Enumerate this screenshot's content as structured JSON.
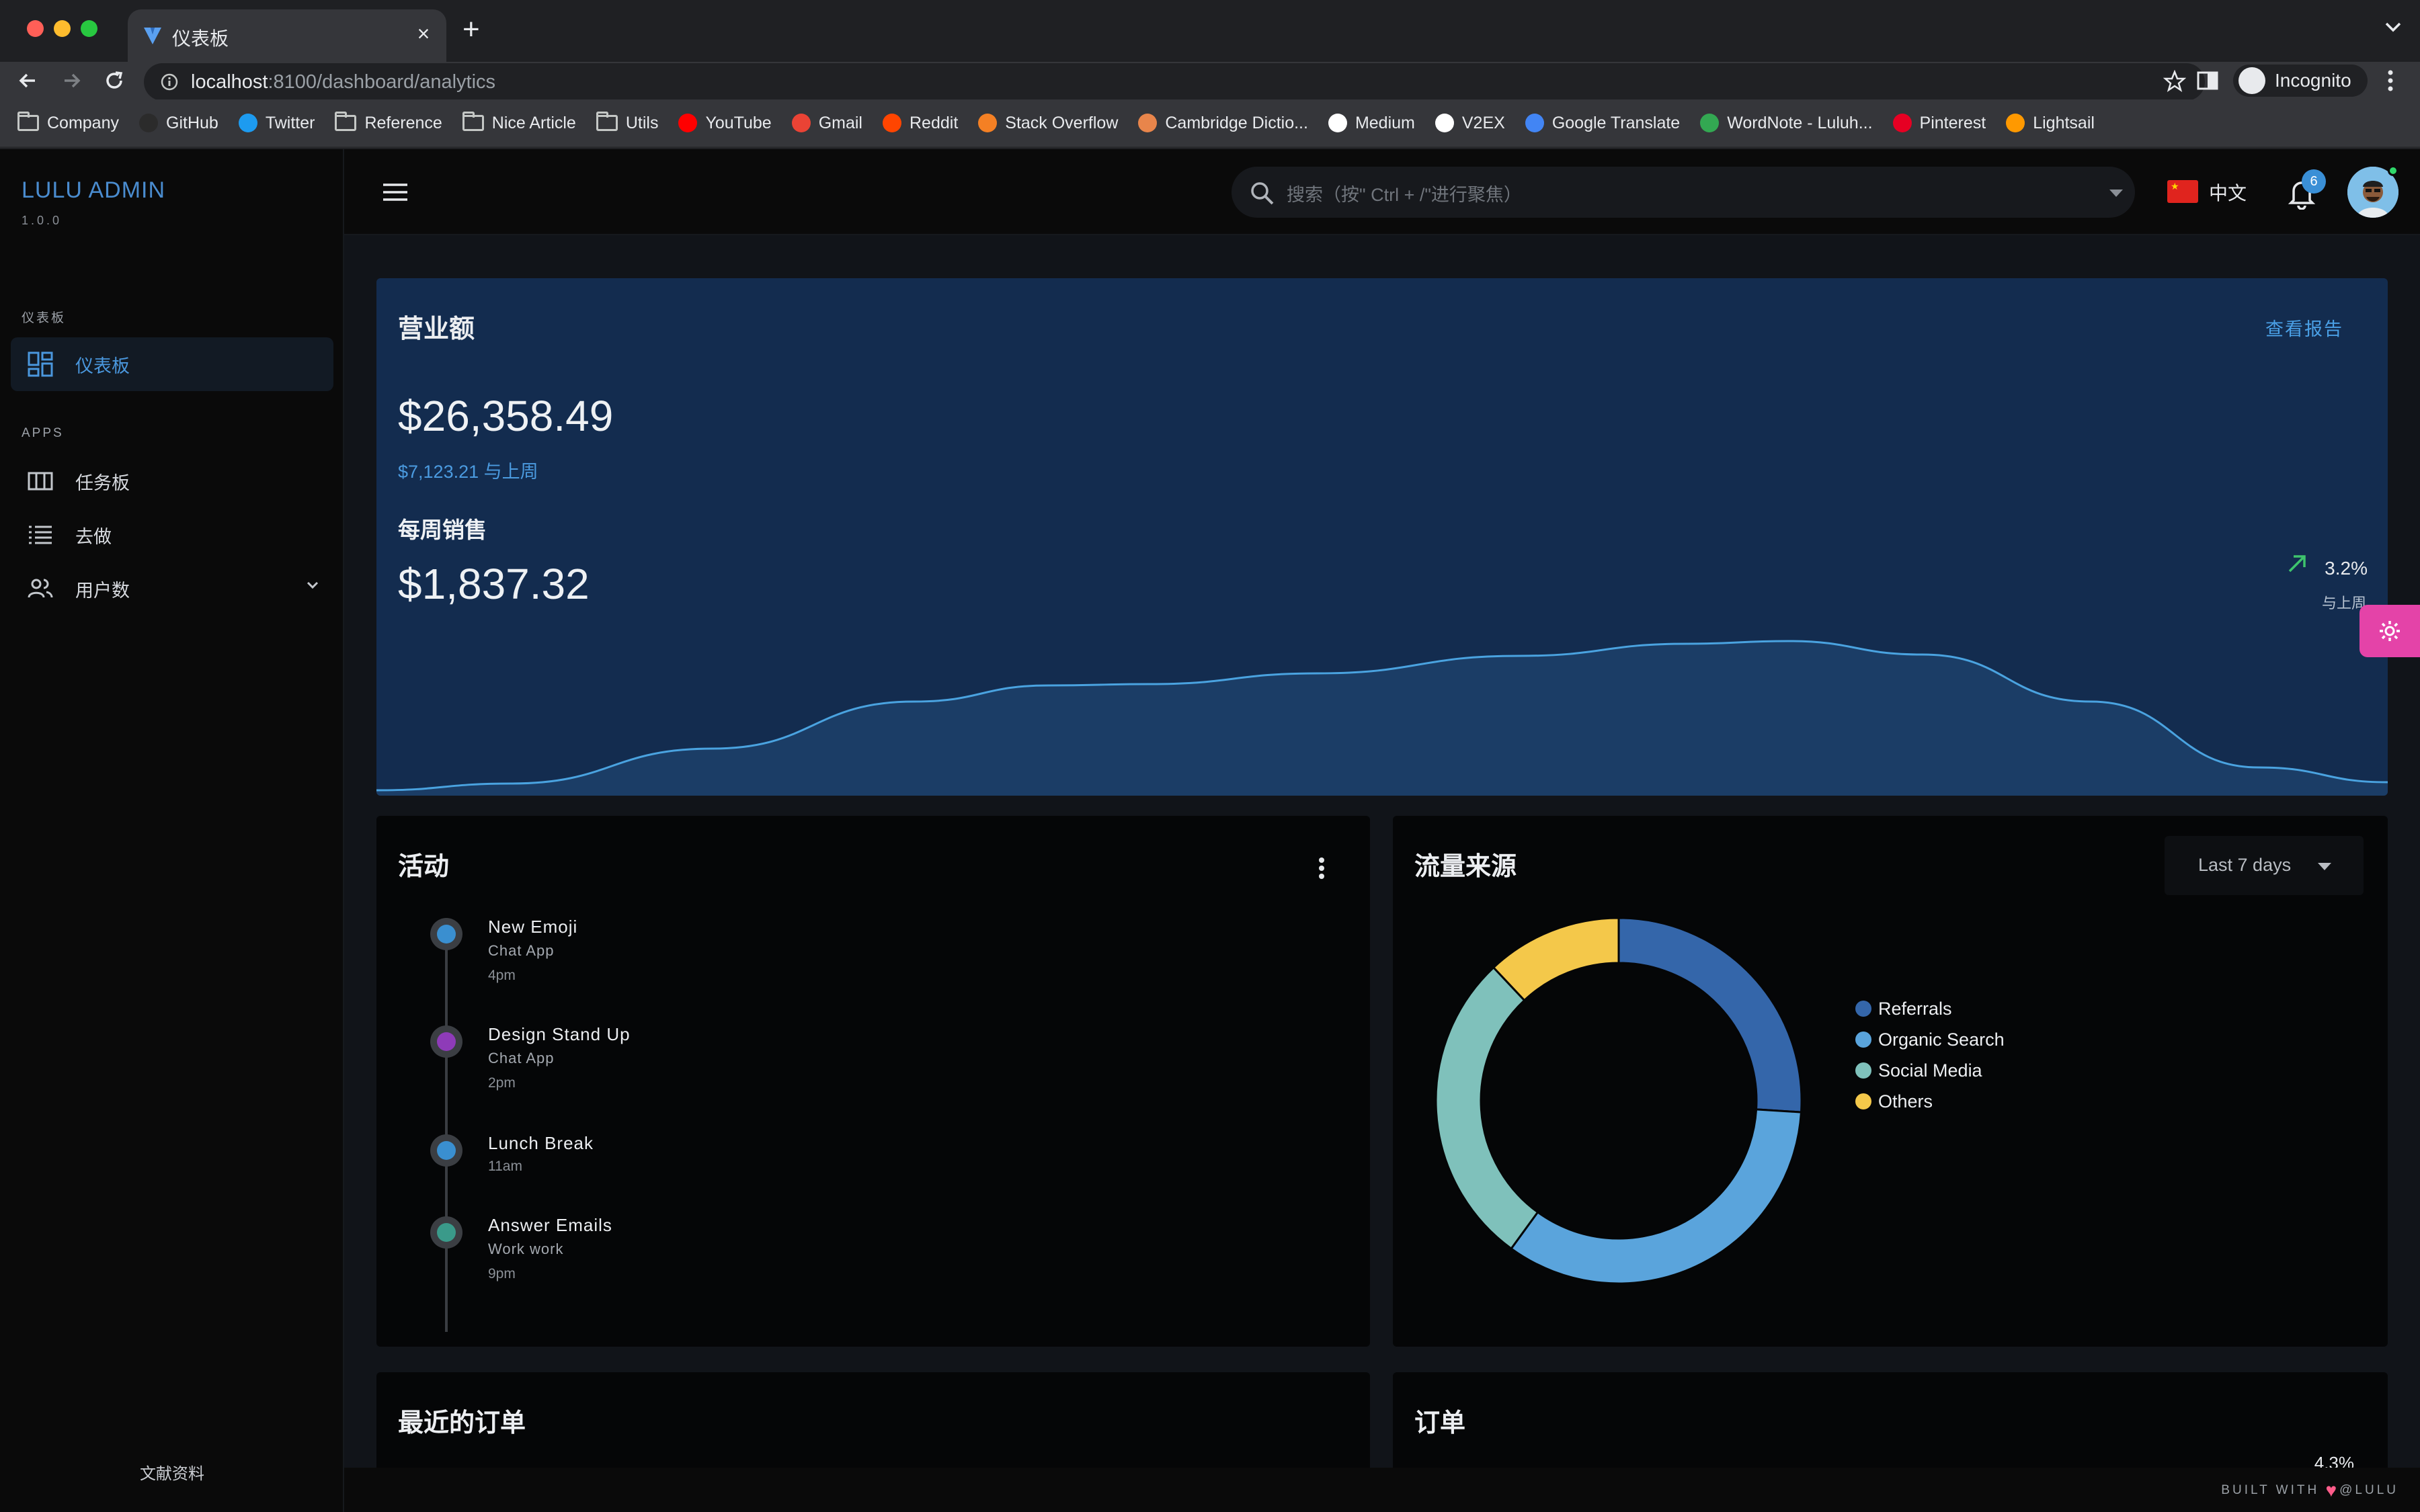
{
  "browser": {
    "tab_title": "仪表板",
    "tab_close": "×",
    "new_tab": "+",
    "url_host": "localhost",
    "url_path": ":8100/dashboard/analytics",
    "profile_label": "Incognito"
  },
  "bookmarks": [
    {
      "label": "Company",
      "icon": "folder-icon"
    },
    {
      "label": "GitHub",
      "icon": "github-icon",
      "color": "#2b2b2b"
    },
    {
      "label": "Twitter",
      "icon": "twitter-icon",
      "color": "#1d9bf0"
    },
    {
      "label": "Reference",
      "icon": "folder-icon"
    },
    {
      "label": "Nice Article",
      "icon": "folder-icon"
    },
    {
      "label": "Utils",
      "icon": "folder-icon"
    },
    {
      "label": "YouTube",
      "icon": "youtube-icon",
      "color": "#ff0000"
    },
    {
      "label": "Gmail",
      "icon": "gmail-icon",
      "color": "#ea4335"
    },
    {
      "label": "Reddit",
      "icon": "reddit-icon",
      "color": "#ff4500"
    },
    {
      "label": "Stack Overflow",
      "icon": "stackoverflow-icon",
      "color": "#f48024"
    },
    {
      "label": "Cambridge Dictio...",
      "icon": "cambridge-icon",
      "color": "#e8854b"
    },
    {
      "label": "Medium",
      "icon": "medium-icon",
      "color": "#ffffff"
    },
    {
      "label": "V2EX",
      "icon": "v2ex-icon",
      "color": "#ffffff"
    },
    {
      "label": "Google Translate",
      "icon": "translate-icon",
      "color": "#4285f4"
    },
    {
      "label": "WordNote - Luluh...",
      "icon": "wordnote-icon",
      "color": "#33a852"
    },
    {
      "label": "Pinterest",
      "icon": "pinterest-icon",
      "color": "#e60023"
    },
    {
      "label": "Lightsail",
      "icon": "lightsail-icon",
      "color": "#ff9900"
    }
  ],
  "sidebar": {
    "brand": "LULU ADMIN",
    "version": "1.0.0",
    "section_dashboard": "仪表板",
    "section_apps": "APPS",
    "items": [
      {
        "label": "仪表板",
        "icon": "dashboard-icon",
        "active": true
      },
      {
        "label": "任务板",
        "icon": "kanban-icon"
      },
      {
        "label": "去做",
        "icon": "todo-list-icon"
      },
      {
        "label": "用户数",
        "icon": "users-icon"
      }
    ],
    "footer": "文献资料"
  },
  "topbar": {
    "search_placeholder": "搜索（按\" Ctrl + /\"进行聚焦）",
    "language": "中文",
    "notification_count": "6"
  },
  "revenue": {
    "title": "营业额",
    "report_link": "查看报告",
    "total": "$26,358.49",
    "compare": "$7,123.21 与上周",
    "weekly_label": "每周销售",
    "weekly_amount": "$1,837.32",
    "delta": "3.2%",
    "delta_label": "与上周",
    "line_color": "#4aa3e0",
    "fill_color": "#1b3d66"
  },
  "activity": {
    "title": "活动",
    "items": [
      {
        "title": "New Emoji",
        "sub": "Chat App",
        "time": "4pm",
        "color": "#3a8fd0"
      },
      {
        "title": "Design Stand Up",
        "sub": "Chat App",
        "time": "2pm",
        "color": "#8e3bb8"
      },
      {
        "title": "Lunch Break",
        "sub": "",
        "time": "11am",
        "color": "#3a8fd0"
      },
      {
        "title": "Answer Emails",
        "sub": "Work work",
        "time": "9pm",
        "color": "#3a9a8a"
      }
    ]
  },
  "traffic": {
    "title": "流量来源",
    "period": "Last 7 days"
  },
  "chart_data": {
    "type": "pie",
    "categories": [
      "Referrals",
      "Organic Search",
      "Social Media",
      "Others"
    ],
    "values": [
      26,
      34,
      28,
      12
    ],
    "colors": [
      "#3466aa",
      "#5aa4dc",
      "#7fc1bb",
      "#f4c84a"
    ],
    "donut": true
  },
  "recent_orders": {
    "title": "最近的订单"
  },
  "orders": {
    "title": "订单",
    "peek": "4.3%"
  },
  "footer": {
    "built_with": "BUILT WITH",
    "author": "@LULU"
  }
}
